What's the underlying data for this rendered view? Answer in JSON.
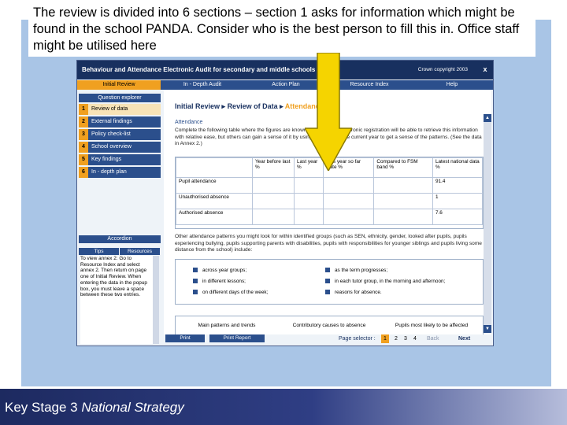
{
  "caption": "The review is divided into 6 sections – section 1 asks for information which might be found in the school PANDA. Consider who is the best person to fill this in. Office staff might be utilised here",
  "footer": {
    "prefix": "Key Stage 3 ",
    "suffix": "National Strategy"
  },
  "app": {
    "title": "Behaviour and Attendance Electronic Audit for secondary and middle schools",
    "copyright": "Crown copyright 2003",
    "close": "x",
    "menu": [
      "Initial Review",
      "In - Depth Audit",
      "Action Plan",
      "Resource Index",
      "Help"
    ],
    "menu_active": 0
  },
  "sidebar": {
    "header": "Question explorer",
    "items": [
      {
        "num": "1",
        "label": "Review of data"
      },
      {
        "num": "2",
        "label": "External findings"
      },
      {
        "num": "3",
        "label": "Policy check-list"
      },
      {
        "num": "4",
        "label": "School overview"
      },
      {
        "num": "5",
        "label": "Key findings"
      },
      {
        "num": "6",
        "label": "In - depth plan"
      }
    ],
    "accordion_header": "Accordion",
    "tabs": [
      "Tips",
      "Resources"
    ],
    "notes": "To view annex 2: Go to Resource Index and select annex 2. Then return on page one of Initial Review. When entering the data in the popup box, you must leave a space between these two entries."
  },
  "main": {
    "breadcrumb": [
      "Initial Review",
      "Review of Data",
      "Attendance"
    ],
    "section_title": "Attendance",
    "intro": "Complete the following table where the figures are known. Schools with electronic registration will be able to retrieve this information with relative ease, but others can gain a sense of it by using registers for the current year to get a sense of the patterns. (See the data in Annex 2.)",
    "table": {
      "headers": [
        "",
        "Year before last %",
        "Last year %",
        "This year so far Date %",
        "Compared to FSM band %",
        "Latest national data %"
      ],
      "rows": [
        {
          "label": "Pupil attendance",
          "national": "91.4"
        },
        {
          "label": "Unauthorised absence",
          "national": "1"
        },
        {
          "label": "Authorised absence",
          "national": "7.6"
        }
      ]
    },
    "other_patterns": "Other attendance patterns you might look for within identified groups (such as SEN, ethnicity, gender, looked after pupils, pupils experiencing bullying, pupils supporting parents with disabilities, pupils with responsibilities for younger siblings and pupils living some distance from the school) include:",
    "checks": [
      "across year groups;",
      "as the term progresses;",
      "in different lessons;",
      "in each tutor group, in the morning and afternoon;",
      "on different days of the week;",
      "reasons for absence."
    ],
    "bottom_headers": [
      "Main patterns and trends",
      "Contributory causes to absence",
      "Pupils most likely to be affected"
    ]
  },
  "toolbar": {
    "print": "Print",
    "print_report": "Print Report",
    "page_selector": "Page selector :",
    "pages": [
      "1",
      "2",
      "3",
      "4"
    ],
    "active_page": "1",
    "back": "Back",
    "next": "Next"
  },
  "colors": {
    "panel": "#a9c5e6",
    "app_title": "#18305f",
    "accent": "#f0a020",
    "arrow": "#f5d400"
  }
}
